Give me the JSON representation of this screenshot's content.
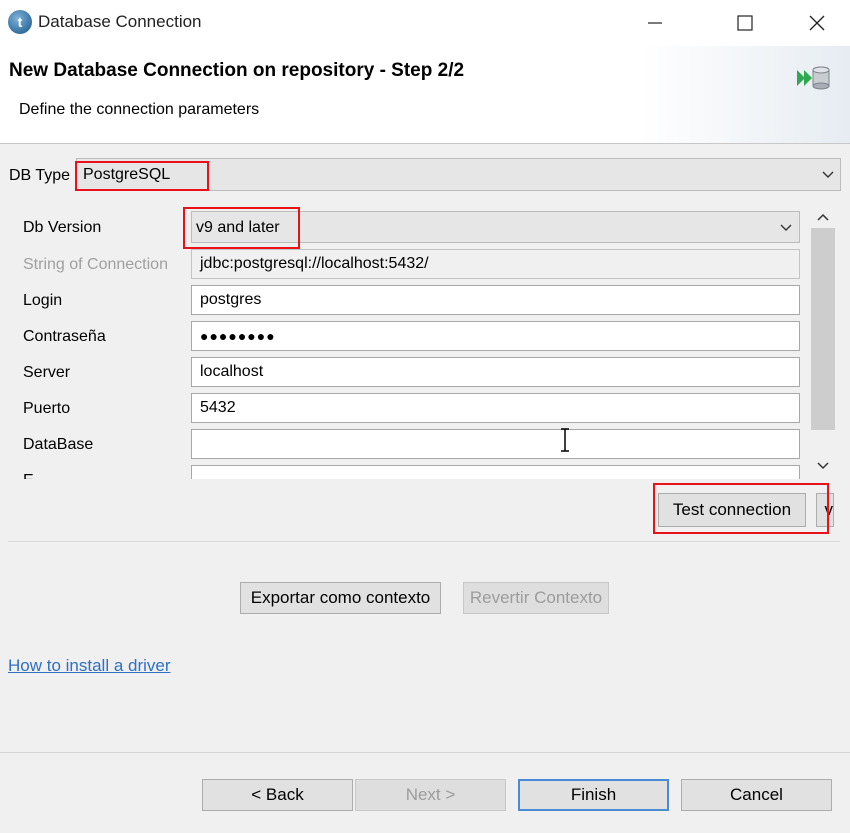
{
  "window": {
    "title": "Database Connection",
    "app_icon_letter": "t",
    "minimize_glyph": "—",
    "maximize_glyph": "☐",
    "close_glyph": "✕"
  },
  "header": {
    "title": "New Database Connection on repository - Step 2/2",
    "subtitle": "Define the connection parameters",
    "icon": "database-wizard-icon"
  },
  "db_type": {
    "label": "DB Type",
    "value": "PostgreSQL"
  },
  "form": {
    "db_version": {
      "label": "Db Version",
      "value": "v9 and later"
    },
    "connection_string": {
      "label": "String of Connection",
      "value": "jdbc:postgresql://localhost:5432/"
    },
    "login": {
      "label": "Login",
      "value": "postgres"
    },
    "password": {
      "label": "Contraseña",
      "value": "●●●●●●●●"
    },
    "server": {
      "label": "Server",
      "value": "localhost"
    },
    "port": {
      "label": "Puerto",
      "value": "5432"
    },
    "database": {
      "label": "DataBase",
      "value": ""
    },
    "next_field_partial": {
      "label": "E",
      "value": ""
    }
  },
  "actions": {
    "test_connection": "Test connection",
    "overflow_label": "v",
    "export_context": "Exportar como contexto",
    "revert_context": "Revertir Contexto"
  },
  "help_link": "How to install a driver",
  "footer": {
    "back": "< Back",
    "next": "Next >",
    "finish": "Finish",
    "cancel": "Cancel"
  },
  "colors": {
    "highlight": "#e8131a",
    "link": "#2f6fc4",
    "default_button_border": "#4a8bd6"
  }
}
